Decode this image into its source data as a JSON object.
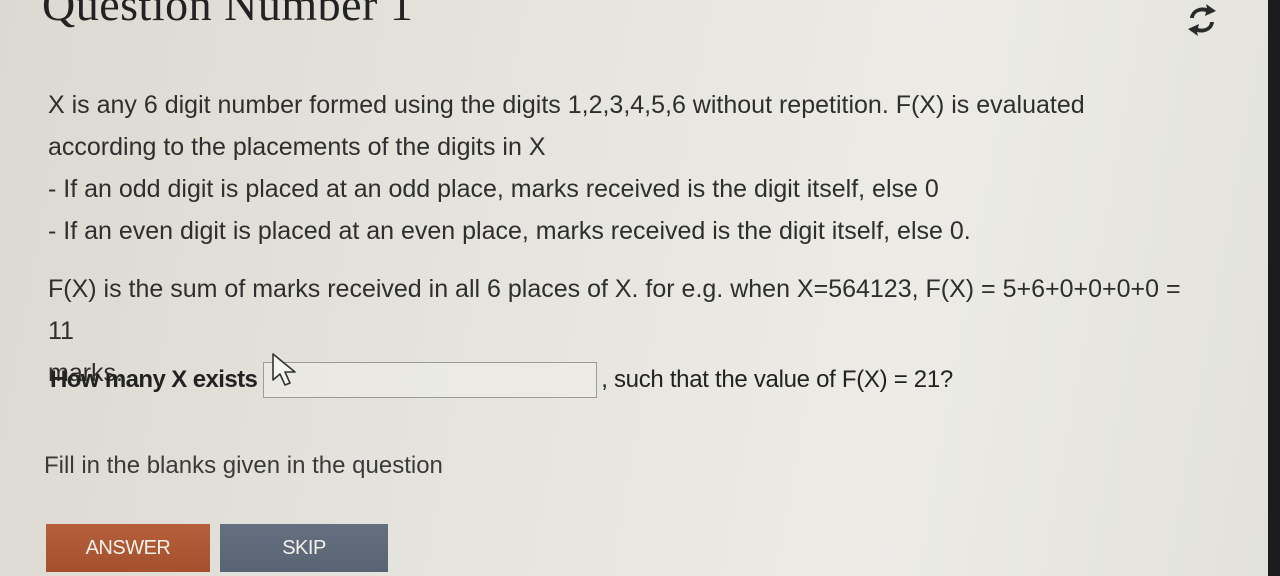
{
  "header": {
    "title": "Question Number 1"
  },
  "question": {
    "lines": [
      "X is any 6 digit number formed using the digits 1,2,3,4,5,6 without repetition. F(X) is evaluated",
      "according to the placements of the digits in X",
      "- If an odd digit is placed at an odd place, marks received is the digit itself, else 0",
      "- If an even digit is placed at an even place, marks received is the digit itself, else 0."
    ],
    "example_lines": [
      "F(X) is the sum of marks received in all 6 places of X. for e.g. when X=564123, F(X) = 5+6+0+0+0+0 = 11",
      "marks."
    ]
  },
  "fill": {
    "prefix": "How many X exists",
    "input_value": "",
    "input_placeholder": "",
    "suffix": ", such that the value of F(X) = 21?"
  },
  "hint": "Fill in the blanks given in the question",
  "buttons": {
    "answer_label": "ANSWER",
    "skip_label": "SKIP"
  },
  "icons": {
    "refresh": "refresh-icon",
    "cursor": "mouse-pointer-icon"
  },
  "colors": {
    "answer_button": "#a8532f",
    "skip_button": "#5c6877",
    "background": "#e6e4de"
  }
}
